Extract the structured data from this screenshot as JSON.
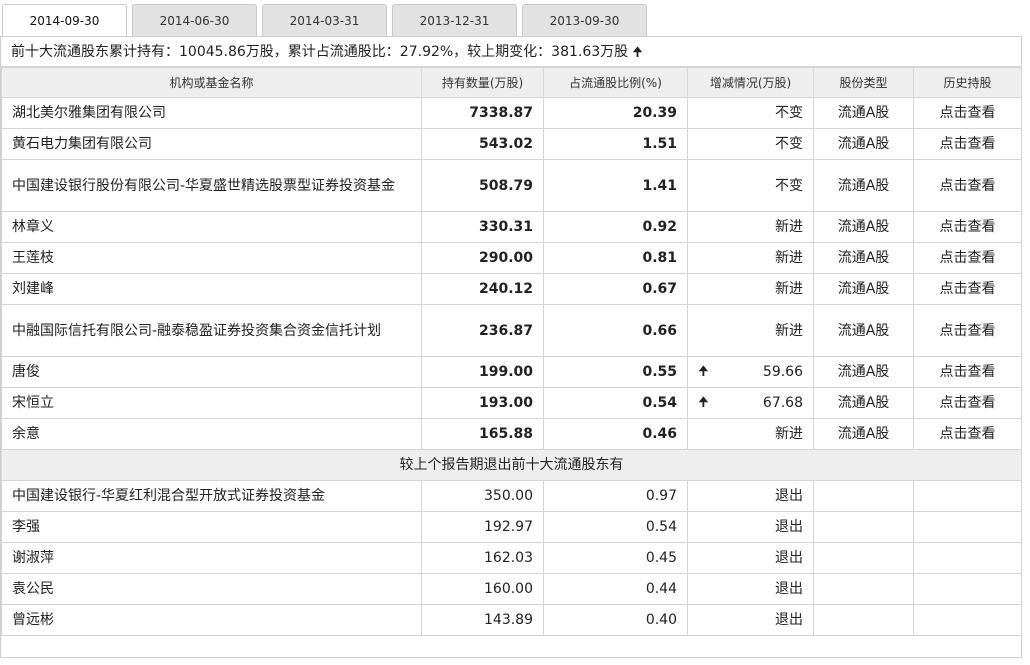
{
  "tabs": [
    "2014-09-30",
    "2014-06-30",
    "2014-03-31",
    "2013-12-31",
    "2013-09-30"
  ],
  "summary": {
    "text": "前十大流通股东累计持有：10045.86万股，累计占流通股比：27.92%，较上期变化：381.63万股",
    "arrow": "🠉"
  },
  "headers": [
    "机构或基金名称",
    "持有数量(万股)",
    "占流通股比例(%)",
    "增减情况(万股)",
    "股份类型",
    "历史持股"
  ],
  "rows": [
    {
      "name": "湖北美尔雅集团有限公司",
      "qty": "7338.87",
      "pct": "20.39",
      "arrow": "",
      "chg": "不变",
      "type": "流通A股",
      "hist": "点击查看"
    },
    {
      "name": "黄石电力集团有限公司",
      "qty": "543.02",
      "pct": "1.51",
      "arrow": "",
      "chg": "不变",
      "type": "流通A股",
      "hist": "点击查看"
    },
    {
      "name": "中国建设银行股份有限公司-华夏盛世精选股票型证券投资基金",
      "qty": "508.79",
      "pct": "1.41",
      "arrow": "",
      "chg": "不变",
      "type": "流通A股",
      "hist": "点击查看"
    },
    {
      "name": "林章义",
      "qty": "330.31",
      "pct": "0.92",
      "arrow": "",
      "chg": "新进",
      "type": "流通A股",
      "hist": "点击查看"
    },
    {
      "name": "王莲枝",
      "qty": "290.00",
      "pct": "0.81",
      "arrow": "",
      "chg": "新进",
      "type": "流通A股",
      "hist": "点击查看"
    },
    {
      "name": "刘建峰",
      "qty": "240.12",
      "pct": "0.67",
      "arrow": "",
      "chg": "新进",
      "type": "流通A股",
      "hist": "点击查看"
    },
    {
      "name": "中融国际信托有限公司-融泰稳盈证券投资集合资金信托计划",
      "qty": "236.87",
      "pct": "0.66",
      "arrow": "",
      "chg": "新进",
      "type": "流通A股",
      "hist": "点击查看"
    },
    {
      "name": "唐俊",
      "qty": "199.00",
      "pct": "0.55",
      "arrow": "🠉",
      "chg": "59.66",
      "type": "流通A股",
      "hist": "点击查看"
    },
    {
      "name": "宋恒立",
      "qty": "193.00",
      "pct": "0.54",
      "arrow": "🠉",
      "chg": "67.68",
      "type": "流通A股",
      "hist": "点击查看"
    },
    {
      "name": "余意",
      "qty": "165.88",
      "pct": "0.46",
      "arrow": "",
      "chg": "新进",
      "type": "流通A股",
      "hist": "点击查看"
    }
  ],
  "exited_title": "较上个报告期退出前十大流通股东有",
  "exited": [
    {
      "name": "中国建设银行-华夏红利混合型开放式证券投资基金",
      "qty": "350.00",
      "pct": "0.97",
      "chg": "退出"
    },
    {
      "name": "李强",
      "qty": "192.97",
      "pct": "0.54",
      "chg": "退出"
    },
    {
      "name": "谢淑萍",
      "qty": "162.03",
      "pct": "0.45",
      "chg": "退出"
    },
    {
      "name": "袁公民",
      "qty": "160.00",
      "pct": "0.44",
      "chg": "退出"
    },
    {
      "name": "曾远彬",
      "qty": "143.89",
      "pct": "0.40",
      "chg": "退出"
    }
  ]
}
